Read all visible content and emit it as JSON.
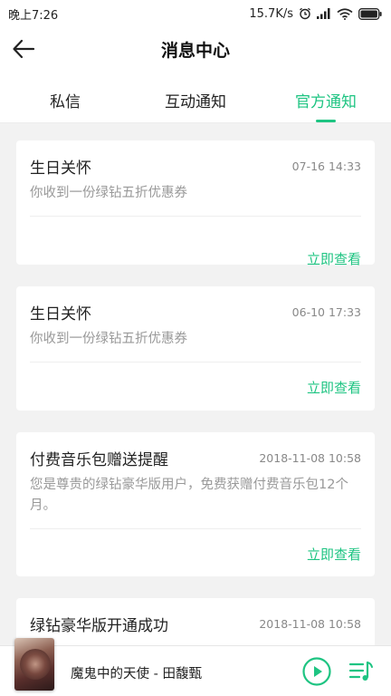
{
  "status_bar": {
    "time": "晚上7:26",
    "network_speed": "15.7K/s",
    "icons": [
      "alarm-icon",
      "signal-icon",
      "wifi-icon",
      "battery-icon"
    ]
  },
  "header": {
    "title": "消息中心",
    "back_icon": "arrow-left-icon"
  },
  "tabs": [
    {
      "label": "私信",
      "active": false
    },
    {
      "label": "互动通知",
      "active": false
    },
    {
      "label": "官方通知",
      "active": true
    }
  ],
  "notifications": [
    {
      "title": "生日关怀",
      "time": "07-16 14:33",
      "body": "你收到一份绿钻五折优惠券",
      "action": "立即查看"
    },
    {
      "title": "生日关怀",
      "time": "06-10 17:33",
      "body": "你收到一份绿钻五折优惠券",
      "action": "立即查看"
    },
    {
      "title": "付费音乐包赠送提醒",
      "time": "2018-11-08 10:58",
      "body": "您是尊贵的绿钻豪华版用户，免费获赠付费音乐包12个月。",
      "action": "立即查看"
    },
    {
      "title": "绿钻豪华版开通成功",
      "time": "2018-11-08 10:58",
      "body": "",
      "action": ""
    }
  ],
  "player": {
    "song": "魔鬼中的天使 - 田馥甄",
    "play_icon": "play-circle-icon",
    "playlist_icon": "playlist-icon"
  },
  "colors": {
    "accent": "#1ec482",
    "background": "#f2f2f2",
    "card": "#ffffff",
    "secondary_text": "#999999"
  }
}
